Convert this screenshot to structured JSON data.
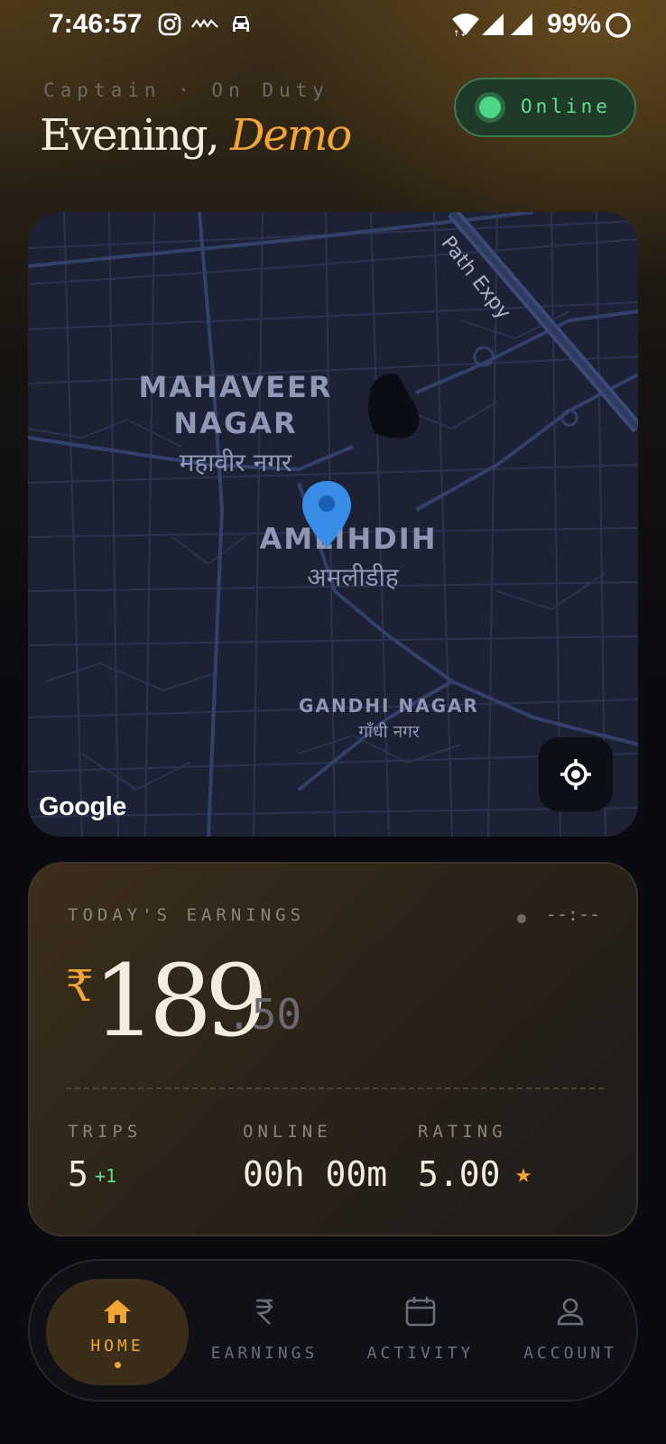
{
  "status_bar": {
    "time": "7:46:57",
    "battery": "99%",
    "icons": [
      "instagram-icon",
      "notification-logo-icon",
      "car-icon",
      "wifi-icon",
      "signal-icon",
      "signal-icon",
      "battery-icon"
    ]
  },
  "header": {
    "eyebrow": "Captain · On Duty",
    "greeting": "Evening,",
    "name": "Demo",
    "status_toggle": {
      "label": "Online",
      "state": "on",
      "color": "#5de08f"
    }
  },
  "map": {
    "labels": {
      "expressway": "Path Expy",
      "mahaveer_en_1": "MAHAVEER",
      "mahaveer_en_2": "NAGAR",
      "mahaveer_hi": "महावीर नगर",
      "amlidih_en": "AMLIHDIH",
      "amlidih_hi": "अमलीडीह",
      "gandhi_en": "GANDHI NAGAR",
      "gandhi_hi": "गाँधी नगर"
    },
    "attribution": "Google",
    "pin_color": "#3a8de6"
  },
  "earnings": {
    "title": "TODAY'S EARNINGS",
    "time": "--:--",
    "currency_symbol": "₹",
    "amount": "189",
    "decimal": ".50",
    "stats": {
      "trips_label": "TRIPS",
      "trips_value": "5",
      "trips_delta": "+1",
      "online_label": "ONLINE",
      "online_value": "00h 00m",
      "rating_label": "RATING",
      "rating_value": "5.00",
      "rating_icon": "★"
    }
  },
  "nav": {
    "items": [
      {
        "label": "HOME",
        "icon": "home-icon",
        "active": true
      },
      {
        "label": "EARNINGS",
        "icon": "rupee-icon",
        "active": false
      },
      {
        "label": "ACTIVITY",
        "icon": "calendar-icon",
        "active": false
      },
      {
        "label": "ACCOUNT",
        "icon": "user-icon",
        "active": false
      }
    ]
  },
  "colors": {
    "accent": "#f0a536",
    "online_green": "#5de08f",
    "background": "#0a0b10"
  }
}
